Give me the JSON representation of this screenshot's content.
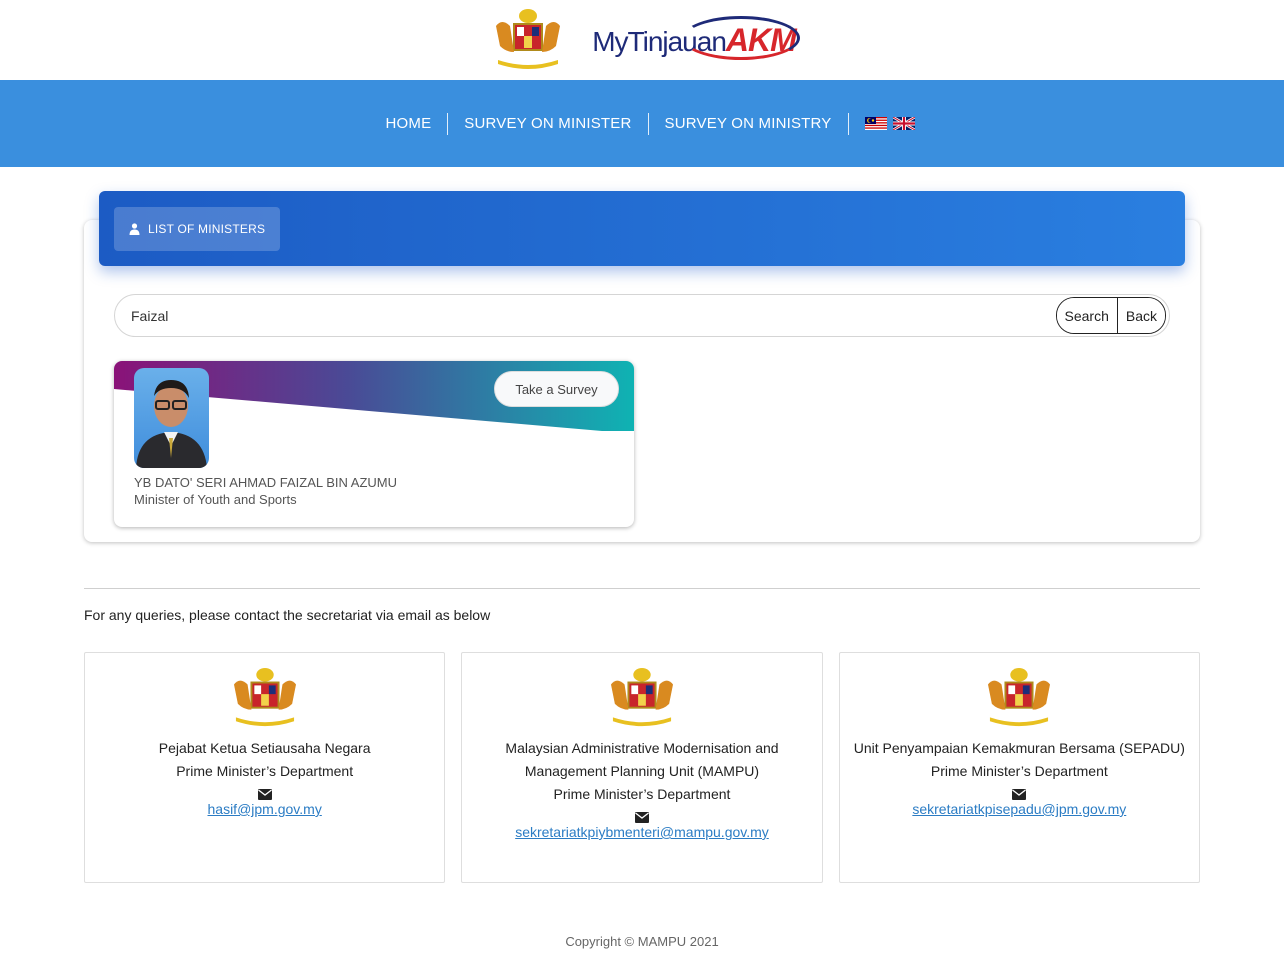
{
  "header": {
    "brand_my": "MyTinjauan",
    "brand_akm": "AKM"
  },
  "nav": {
    "items": [
      "HOME",
      "SURVEY ON MINISTER",
      "SURVEY ON MINISTRY"
    ],
    "flags": [
      "malaysia-flag-icon",
      "uk-flag-icon"
    ]
  },
  "panel": {
    "tab_label": "LIST OF MINISTERS",
    "search_value": "Faizal",
    "search_button": "Search",
    "back_button": "Back"
  },
  "minister": {
    "name": "YB DATO' SERI AHMAD FAIZAL BIN AZUMU",
    "role": "Minister of Youth and Sports",
    "survey_button": "Take a Survey"
  },
  "footer": {
    "queries_text": "For any queries, please contact the secretariat via email as below",
    "contacts": [
      {
        "lines": [
          "Pejabat Ketua Setiausaha Negara",
          "Prime Minister’s Department"
        ],
        "email": "hasif@jpm.gov.my"
      },
      {
        "lines": [
          "Malaysian Administrative Modernisation and",
          "Management Planning Unit (MAMPU)",
          "Prime Minister’s Department"
        ],
        "email": "sekretariatkpiybmenteri@mampu.gov.my"
      },
      {
        "lines": [
          "Unit Penyampaian Kemakmuran Bersama (SEPADU)",
          "Prime Minister’s Department"
        ],
        "email": "sekretariatkpisepadu@jpm.gov.my"
      }
    ],
    "copyright": "Copyright © MAMPU 2021"
  },
  "colors": {
    "navbar": "#3a8fde",
    "header_gradient_start": "#1c5bc4",
    "header_gradient_end": "#2a7fe0",
    "link": "#2b7cc4"
  }
}
